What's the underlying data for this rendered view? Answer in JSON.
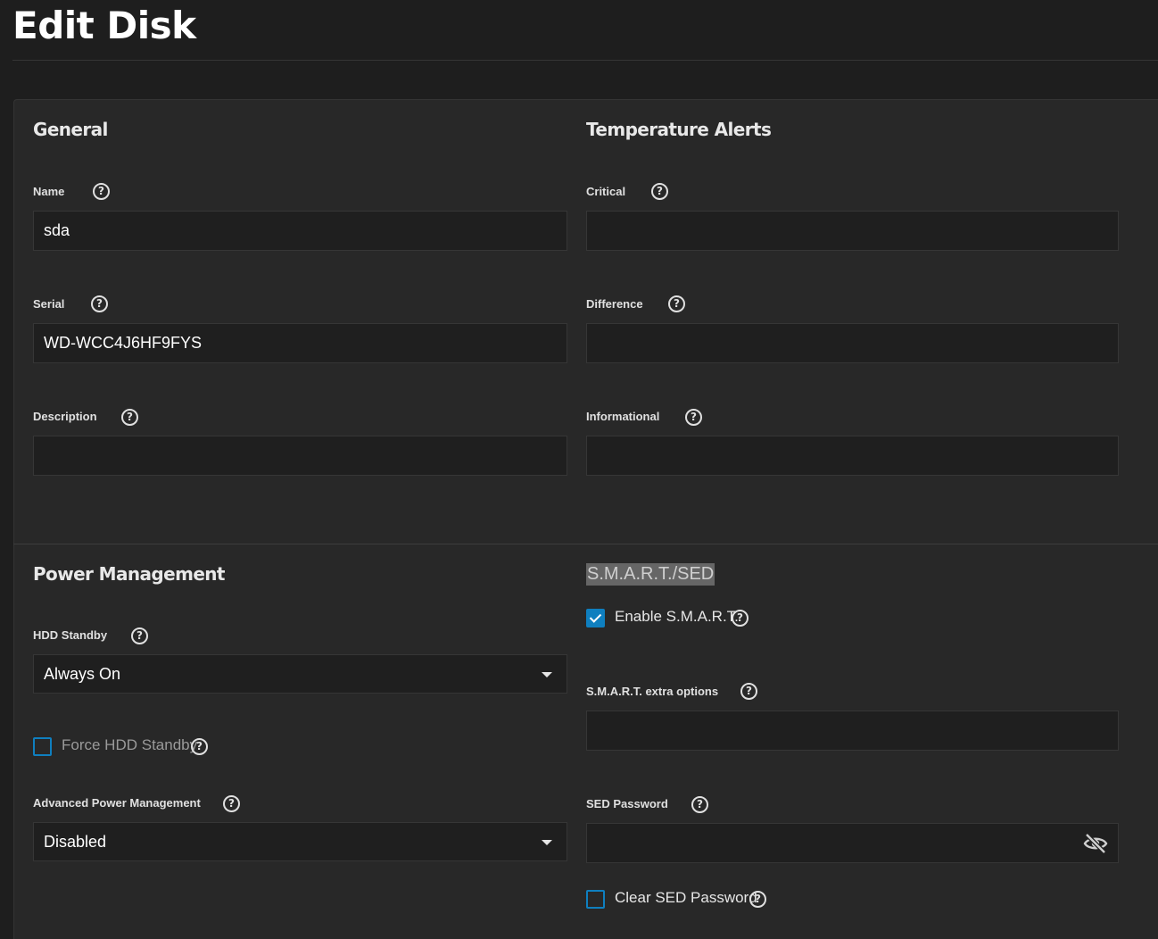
{
  "page": {
    "title": "Edit Disk"
  },
  "general": {
    "title": "General",
    "name": {
      "label": "Name",
      "value": "sda"
    },
    "serial": {
      "label": "Serial",
      "value": "WD-WCC4J6HF9FYS"
    },
    "description": {
      "label": "Description",
      "value": ""
    }
  },
  "temperature": {
    "title": "Temperature Alerts",
    "critical": {
      "label": "Critical",
      "value": ""
    },
    "difference": {
      "label": "Difference",
      "value": ""
    },
    "informational": {
      "label": "Informational",
      "value": ""
    }
  },
  "power": {
    "title": "Power Management",
    "hdd_standby": {
      "label": "HDD Standby",
      "value": "Always On"
    },
    "force_standby": {
      "label": "Force HDD Standby",
      "checked": false
    },
    "apm": {
      "label": "Advanced Power Management",
      "value": "Disabled"
    }
  },
  "smart": {
    "title": "S.M.A.R.T./SED",
    "enable": {
      "label": "Enable S.M.A.R.T.",
      "checked": true
    },
    "extra_options": {
      "label": "S.M.A.R.T. extra options",
      "value": ""
    },
    "sed_password": {
      "label": "SED Password",
      "value": "",
      "icon": "eye-off-icon"
    },
    "clear_sed": {
      "label": "Clear SED Password",
      "checked": false
    }
  },
  "icons": {
    "help": "?",
    "help_name": "help-icon"
  },
  "colors": {
    "accent": "#0f7fbf",
    "background": "#1e1e1e",
    "card": "#282828",
    "input": "#1f1f1f"
  }
}
